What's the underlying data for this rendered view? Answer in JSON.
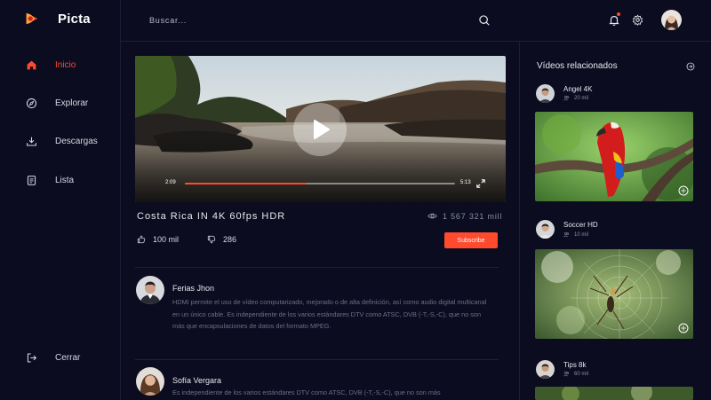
{
  "brand": {
    "name": "Picta",
    "accent": "#ff4a2e"
  },
  "nav": [
    {
      "label": "Inicio",
      "icon": "home-icon",
      "active": true
    },
    {
      "label": "Explorar",
      "icon": "compass-icon",
      "active": false
    },
    {
      "label": "Descargas",
      "icon": "download-icon",
      "active": false
    },
    {
      "label": "Lista",
      "icon": "list-icon",
      "active": false
    }
  ],
  "logout": {
    "label": "Cerrar",
    "icon": "logout-icon"
  },
  "header": {
    "search_placeholder": "Buscar...",
    "icons": [
      "search-icon",
      "bell-icon",
      "gear-icon"
    ]
  },
  "player": {
    "current_time": "2:09",
    "duration": "5:13",
    "progress": 0.45
  },
  "video": {
    "title": "Costa Rica IN 4K 60fps HDR",
    "views": "1 567 321 mill",
    "likes": "100 mil",
    "dislikes": "286",
    "subscribe_label": "Subscribe"
  },
  "comments": [
    {
      "author": "Ferias Jhon",
      "text": "HDMI permite el uso de vídeo computarizado, mejorado o de alta definición, así como audio digital multicanal en un único cable. Es independiente de los varios estándares DTV como ATSC, DVB (-T,-S,-C), que no son más que encapsulaciones de datos del formato MPEG."
    },
    {
      "author": "Sofía Vergara",
      "text": "Es independiente de los varios estándares DTV como ATSC, DVB (-T,-S,-C), que no son más"
    }
  ],
  "related": {
    "title": "Vídeos relacionados",
    "items": [
      {
        "channel": "Angel 4K",
        "subs": "20 mil"
      },
      {
        "channel": "Soccer HD",
        "subs": "10 mil"
      },
      {
        "channel": "Tips 8k",
        "subs": "60 mil"
      }
    ]
  }
}
